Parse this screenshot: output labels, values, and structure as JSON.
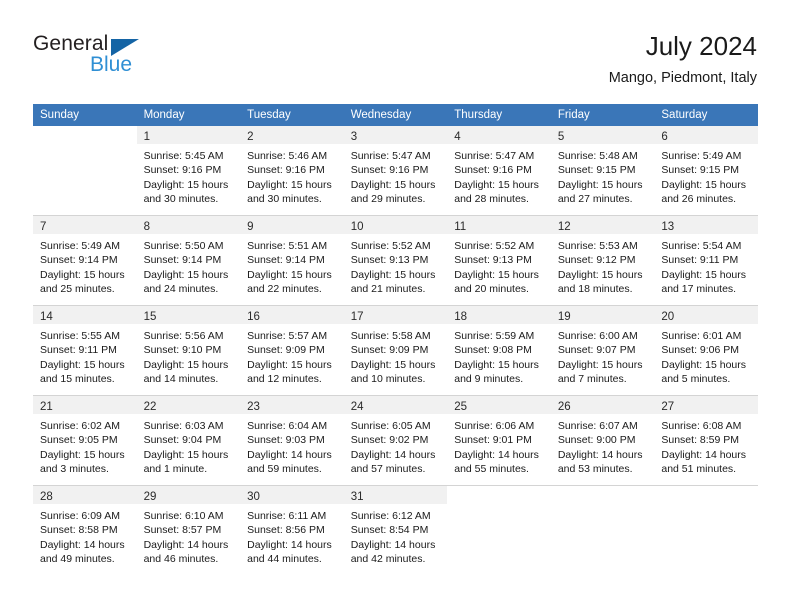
{
  "brand": {
    "name_part1": "General",
    "name_part2": "Blue",
    "triangle_icon": "blue-triangle-logo-mark",
    "colors": {
      "dark": "#231f20",
      "blue": "#2f8fd4",
      "triangle": "#1464a5"
    }
  },
  "header": {
    "title": "July 2024",
    "subtitle": "Mango, Piedmont, Italy"
  },
  "theme": {
    "header_bar": "#3a76b8",
    "daynum_strip": "#f1f1f1",
    "row_divider": "#d4d4d4",
    "text": "#1a1a1a"
  },
  "weekday_headers": [
    "Sunday",
    "Monday",
    "Tuesday",
    "Wednesday",
    "Thursday",
    "Friday",
    "Saturday"
  ],
  "weeks": [
    [
      {
        "empty": true
      },
      {
        "day": "1",
        "sunrise": "Sunrise: 5:45 AM",
        "sunset": "Sunset: 9:16 PM",
        "daylight": "Daylight: 15 hours and 30 minutes."
      },
      {
        "day": "2",
        "sunrise": "Sunrise: 5:46 AM",
        "sunset": "Sunset: 9:16 PM",
        "daylight": "Daylight: 15 hours and 30 minutes."
      },
      {
        "day": "3",
        "sunrise": "Sunrise: 5:47 AM",
        "sunset": "Sunset: 9:16 PM",
        "daylight": "Daylight: 15 hours and 29 minutes."
      },
      {
        "day": "4",
        "sunrise": "Sunrise: 5:47 AM",
        "sunset": "Sunset: 9:16 PM",
        "daylight": "Daylight: 15 hours and 28 minutes."
      },
      {
        "day": "5",
        "sunrise": "Sunrise: 5:48 AM",
        "sunset": "Sunset: 9:15 PM",
        "daylight": "Daylight: 15 hours and 27 minutes."
      },
      {
        "day": "6",
        "sunrise": "Sunrise: 5:49 AM",
        "sunset": "Sunset: 9:15 PM",
        "daylight": "Daylight: 15 hours and 26 minutes."
      }
    ],
    [
      {
        "day": "7",
        "sunrise": "Sunrise: 5:49 AM",
        "sunset": "Sunset: 9:14 PM",
        "daylight": "Daylight: 15 hours and 25 minutes."
      },
      {
        "day": "8",
        "sunrise": "Sunrise: 5:50 AM",
        "sunset": "Sunset: 9:14 PM",
        "daylight": "Daylight: 15 hours and 24 minutes."
      },
      {
        "day": "9",
        "sunrise": "Sunrise: 5:51 AM",
        "sunset": "Sunset: 9:14 PM",
        "daylight": "Daylight: 15 hours and 22 minutes."
      },
      {
        "day": "10",
        "sunrise": "Sunrise: 5:52 AM",
        "sunset": "Sunset: 9:13 PM",
        "daylight": "Daylight: 15 hours and 21 minutes."
      },
      {
        "day": "11",
        "sunrise": "Sunrise: 5:52 AM",
        "sunset": "Sunset: 9:13 PM",
        "daylight": "Daylight: 15 hours and 20 minutes."
      },
      {
        "day": "12",
        "sunrise": "Sunrise: 5:53 AM",
        "sunset": "Sunset: 9:12 PM",
        "daylight": "Daylight: 15 hours and 18 minutes."
      },
      {
        "day": "13",
        "sunrise": "Sunrise: 5:54 AM",
        "sunset": "Sunset: 9:11 PM",
        "daylight": "Daylight: 15 hours and 17 minutes."
      }
    ],
    [
      {
        "day": "14",
        "sunrise": "Sunrise: 5:55 AM",
        "sunset": "Sunset: 9:11 PM",
        "daylight": "Daylight: 15 hours and 15 minutes."
      },
      {
        "day": "15",
        "sunrise": "Sunrise: 5:56 AM",
        "sunset": "Sunset: 9:10 PM",
        "daylight": "Daylight: 15 hours and 14 minutes."
      },
      {
        "day": "16",
        "sunrise": "Sunrise: 5:57 AM",
        "sunset": "Sunset: 9:09 PM",
        "daylight": "Daylight: 15 hours and 12 minutes."
      },
      {
        "day": "17",
        "sunrise": "Sunrise: 5:58 AM",
        "sunset": "Sunset: 9:09 PM",
        "daylight": "Daylight: 15 hours and 10 minutes."
      },
      {
        "day": "18",
        "sunrise": "Sunrise: 5:59 AM",
        "sunset": "Sunset: 9:08 PM",
        "daylight": "Daylight: 15 hours and 9 minutes."
      },
      {
        "day": "19",
        "sunrise": "Sunrise: 6:00 AM",
        "sunset": "Sunset: 9:07 PM",
        "daylight": "Daylight: 15 hours and 7 minutes."
      },
      {
        "day": "20",
        "sunrise": "Sunrise: 6:01 AM",
        "sunset": "Sunset: 9:06 PM",
        "daylight": "Daylight: 15 hours and 5 minutes."
      }
    ],
    [
      {
        "day": "21",
        "sunrise": "Sunrise: 6:02 AM",
        "sunset": "Sunset: 9:05 PM",
        "daylight": "Daylight: 15 hours and 3 minutes."
      },
      {
        "day": "22",
        "sunrise": "Sunrise: 6:03 AM",
        "sunset": "Sunset: 9:04 PM",
        "daylight": "Daylight: 15 hours and 1 minute."
      },
      {
        "day": "23",
        "sunrise": "Sunrise: 6:04 AM",
        "sunset": "Sunset: 9:03 PM",
        "daylight": "Daylight: 14 hours and 59 minutes."
      },
      {
        "day": "24",
        "sunrise": "Sunrise: 6:05 AM",
        "sunset": "Sunset: 9:02 PM",
        "daylight": "Daylight: 14 hours and 57 minutes."
      },
      {
        "day": "25",
        "sunrise": "Sunrise: 6:06 AM",
        "sunset": "Sunset: 9:01 PM",
        "daylight": "Daylight: 14 hours and 55 minutes."
      },
      {
        "day": "26",
        "sunrise": "Sunrise: 6:07 AM",
        "sunset": "Sunset: 9:00 PM",
        "daylight": "Daylight: 14 hours and 53 minutes."
      },
      {
        "day": "27",
        "sunrise": "Sunrise: 6:08 AM",
        "sunset": "Sunset: 8:59 PM",
        "daylight": "Daylight: 14 hours and 51 minutes."
      }
    ],
    [
      {
        "day": "28",
        "sunrise": "Sunrise: 6:09 AM",
        "sunset": "Sunset: 8:58 PM",
        "daylight": "Daylight: 14 hours and 49 minutes."
      },
      {
        "day": "29",
        "sunrise": "Sunrise: 6:10 AM",
        "sunset": "Sunset: 8:57 PM",
        "daylight": "Daylight: 14 hours and 46 minutes."
      },
      {
        "day": "30",
        "sunrise": "Sunrise: 6:11 AM",
        "sunset": "Sunset: 8:56 PM",
        "daylight": "Daylight: 14 hours and 44 minutes."
      },
      {
        "day": "31",
        "sunrise": "Sunrise: 6:12 AM",
        "sunset": "Sunset: 8:54 PM",
        "daylight": "Daylight: 14 hours and 42 minutes."
      },
      {
        "empty": true
      },
      {
        "empty": true
      },
      {
        "empty": true
      }
    ]
  ]
}
